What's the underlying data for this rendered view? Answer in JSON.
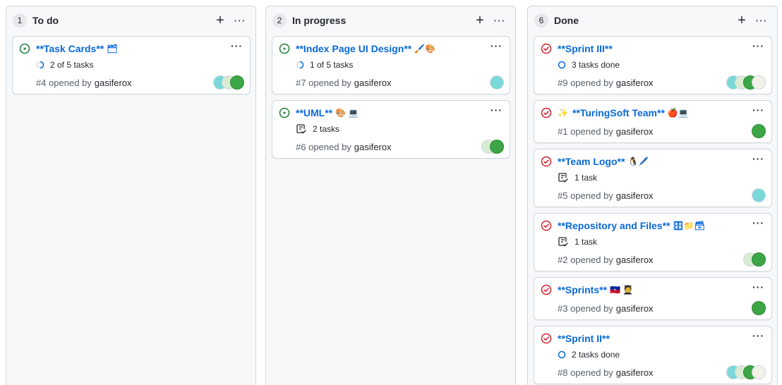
{
  "columns": [
    {
      "count": "1",
      "title": "To do",
      "cards": [
        {
          "title": "**Task Cards**",
          "emoji": "🗂",
          "status": "open",
          "tasks": "2 of 5 tasks",
          "task_icon": "progress",
          "opened": "#4 opened by",
          "user": "gasiferox",
          "avatars": [
            "teal",
            "light",
            "green"
          ]
        }
      ]
    },
    {
      "count": "2",
      "title": "In progress",
      "cards": [
        {
          "title": "**Index Page UI Design**",
          "emoji": "🖌️🎨",
          "status": "open",
          "tasks": "1 of 5 tasks",
          "task_icon": "progress",
          "opened": "#7 opened by",
          "user": "gasiferox",
          "avatars": [
            "teal"
          ]
        },
        {
          "title": "**UML**",
          "emoji": "🎨 💻",
          "status": "open",
          "tasks": "2 tasks",
          "task_icon": "checklist",
          "opened": "#6 opened by",
          "user": "gasiferox",
          "avatars": [
            "light",
            "green"
          ]
        }
      ]
    },
    {
      "count": "6",
      "title": "Done",
      "cards": [
        {
          "title": "**Sprint III**",
          "emoji": "",
          "status": "closed",
          "tasks": "3 tasks done",
          "task_icon": "circle",
          "opened": "#9 opened by",
          "user": "gasiferox",
          "avatars": [
            "teal",
            "light",
            "green",
            "cream"
          ]
        },
        {
          "title": "**TuringSoft Team**",
          "emoji": "✨🍎💻",
          "lead_emoji": "✨",
          "status": "closed",
          "tasks": "",
          "task_icon": "",
          "opened": "#1 opened by",
          "user": "gasiferox",
          "avatars": [
            "green"
          ]
        },
        {
          "title": "**Team Logo**",
          "emoji": "🐧🖊️",
          "status": "closed",
          "tasks": "1 task",
          "task_icon": "checklist",
          "opened": "#5 opened by",
          "user": "gasiferox",
          "avatars": [
            "teal"
          ]
        },
        {
          "title": "**Repository and Files**",
          "emoji": "🗄📁🗃",
          "status": "closed",
          "tasks": "1 task",
          "task_icon": "checklist",
          "opened": "#2 opened by",
          "user": "gasiferox",
          "avatars": [
            "light",
            "green"
          ]
        },
        {
          "title": "**Sprints**",
          "emoji": "🇭🇹 🧑‍🎓",
          "status": "closed",
          "tasks": "",
          "task_icon": "",
          "opened": "#3 opened by",
          "user": "gasiferox",
          "avatars": [
            "green"
          ]
        },
        {
          "title": "**Sprint II**",
          "emoji": "",
          "status": "closed",
          "tasks": "2 tasks done",
          "task_icon": "circle",
          "opened": "#8 opened by",
          "user": "gasiferox",
          "avatars": [
            "teal",
            "light",
            "green",
            "cream"
          ]
        }
      ]
    }
  ],
  "colors": {
    "open": "#1a7f37",
    "closed": "#cf222e",
    "link": "#0969da",
    "progress": "#0969da"
  }
}
